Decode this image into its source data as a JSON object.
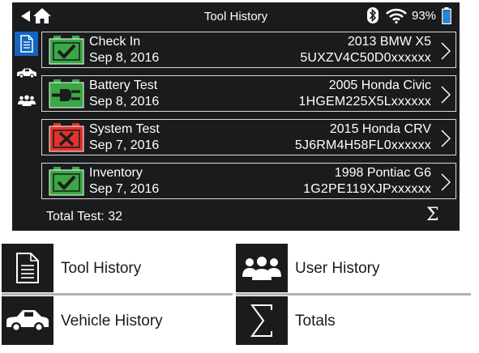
{
  "screen": {
    "title": "Tool History",
    "battery_percent": "93%",
    "colors": {
      "background": "#1a1b1d",
      "active_tab": "#1565c0",
      "pass": "#39a845",
      "fail": "#e0332b"
    },
    "side_tabs": [
      {
        "icon": "document-icon",
        "active": true
      },
      {
        "icon": "car-icon",
        "active": false
      },
      {
        "icon": "users-icon",
        "active": false
      }
    ],
    "rows": [
      {
        "type": "Check In",
        "date": "Sep 8, 2016",
        "vehicle": "2013 BMW X5",
        "vin": "5UXZV4C50D0xxxxxx",
        "status_icon": "check-icon",
        "status": "pass"
      },
      {
        "type": "Battery Test",
        "date": "Sep 8, 2016",
        "vehicle": "2005 Honda Civic",
        "vin": "1HGEM225X5Lxxxxxx",
        "status_icon": "plug-icon",
        "status": "pass"
      },
      {
        "type": "System Test",
        "date": "Sep 7, 2016",
        "vehicle": "2015 Honda CRV",
        "vin": "5J6RM4H58FL0xxxxxx",
        "status_icon": "x-icon",
        "status": "fail"
      },
      {
        "type": "Inventory",
        "date": "Sep 7, 2016",
        "vehicle": "1998 Pontiac G6",
        "vin": "1G2PE119XJPxxxxxx",
        "status_icon": "check-icon",
        "status": "pass"
      }
    ],
    "total_label": "Total Test:  32",
    "totals_symbol": "Σ"
  },
  "legend": [
    {
      "icon": "document-icon",
      "label": "Tool History"
    },
    {
      "icon": "users-icon",
      "label": "User History"
    },
    {
      "icon": "car-icon",
      "label": "Vehicle History"
    },
    {
      "icon": "sigma-icon",
      "label": "Totals"
    }
  ]
}
